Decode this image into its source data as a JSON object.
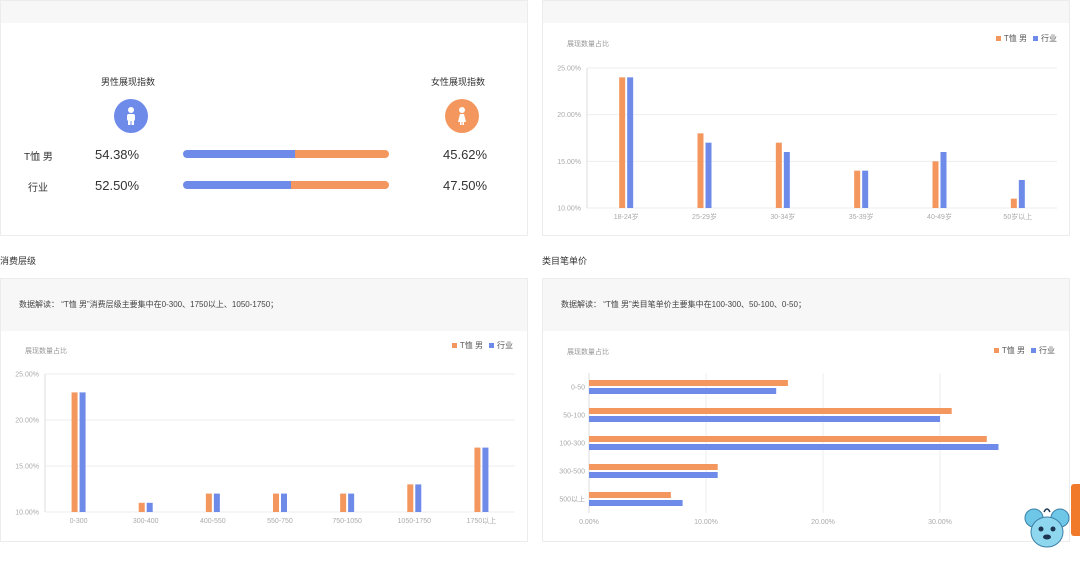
{
  "colors": {
    "primary": "#f4975e",
    "secondary": "#6f8bea"
  },
  "gender": {
    "male_title": "男性展现指数",
    "female_title": "女性展现指数",
    "rows": [
      {
        "label": "T恤 男",
        "male": "54.38%",
        "female": "45.62%",
        "male_fraction": 0.5438
      },
      {
        "label": "行业",
        "male": "52.50%",
        "female": "47.50%",
        "male_fraction": 0.525
      }
    ]
  },
  "consumption": {
    "section_title": "消费层级",
    "note": "数据解读：  “T恤 男”消费层级主要集中在0-300、1750以上、1050-1750；"
  },
  "category_price": {
    "section_title": "类目笔单价",
    "note": "数据解读：  “T恤 男”类目笔单价主要集中在100-300、50-100、0-50；"
  },
  "chart_data": [
    {
      "id": "age",
      "type": "bar",
      "ylabel": "展现数量占比",
      "categories": [
        "18-24岁",
        "25-29岁",
        "30-34岁",
        "35-39岁",
        "40-49岁",
        "50岁以上"
      ],
      "series": [
        {
          "name": "T恤 男",
          "values": [
            24,
            18,
            17,
            14,
            15,
            11
          ]
        },
        {
          "name": "行业",
          "values": [
            24,
            17,
            16,
            14,
            16,
            13
          ]
        }
      ],
      "yticks": [
        "10.00%",
        "15.00%",
        "20.00%",
        "25.00%"
      ],
      "ylim": [
        10,
        25
      ],
      "grid": true,
      "legend": "top-right"
    },
    {
      "id": "consumption",
      "type": "bar",
      "ylabel": "展现数量占比",
      "categories": [
        "0-300",
        "300-400",
        "400-550",
        "550-750",
        "750-1050",
        "1050-1750",
        "1750以上"
      ],
      "series": [
        {
          "name": "T恤 男",
          "values": [
            23,
            11,
            12,
            12,
            12,
            13,
            17
          ]
        },
        {
          "name": "行业",
          "values": [
            23,
            11,
            12,
            12,
            12,
            13,
            17
          ]
        }
      ],
      "yticks": [
        "10.00%",
        "15.00%",
        "20.00%",
        "25.00%"
      ],
      "ylim": [
        10,
        25
      ],
      "grid": true,
      "legend": "top-right"
    },
    {
      "id": "price",
      "type": "bar",
      "orientation": "horizontal",
      "ylabel": "展现数量占比",
      "categories": [
        "0-50",
        "50-100",
        "100-300",
        "300-500",
        "500以上"
      ],
      "series": [
        {
          "name": "T恤 男",
          "values": [
            17,
            31,
            34,
            11,
            7
          ]
        },
        {
          "name": "行业",
          "values": [
            16,
            30,
            35,
            11,
            8
          ]
        }
      ],
      "xticks": [
        "0.00%",
        "10.00%",
        "20.00%",
        "30.00%"
      ],
      "xlim": [
        0,
        40
      ],
      "grid": true,
      "legend": "top-right"
    }
  ]
}
